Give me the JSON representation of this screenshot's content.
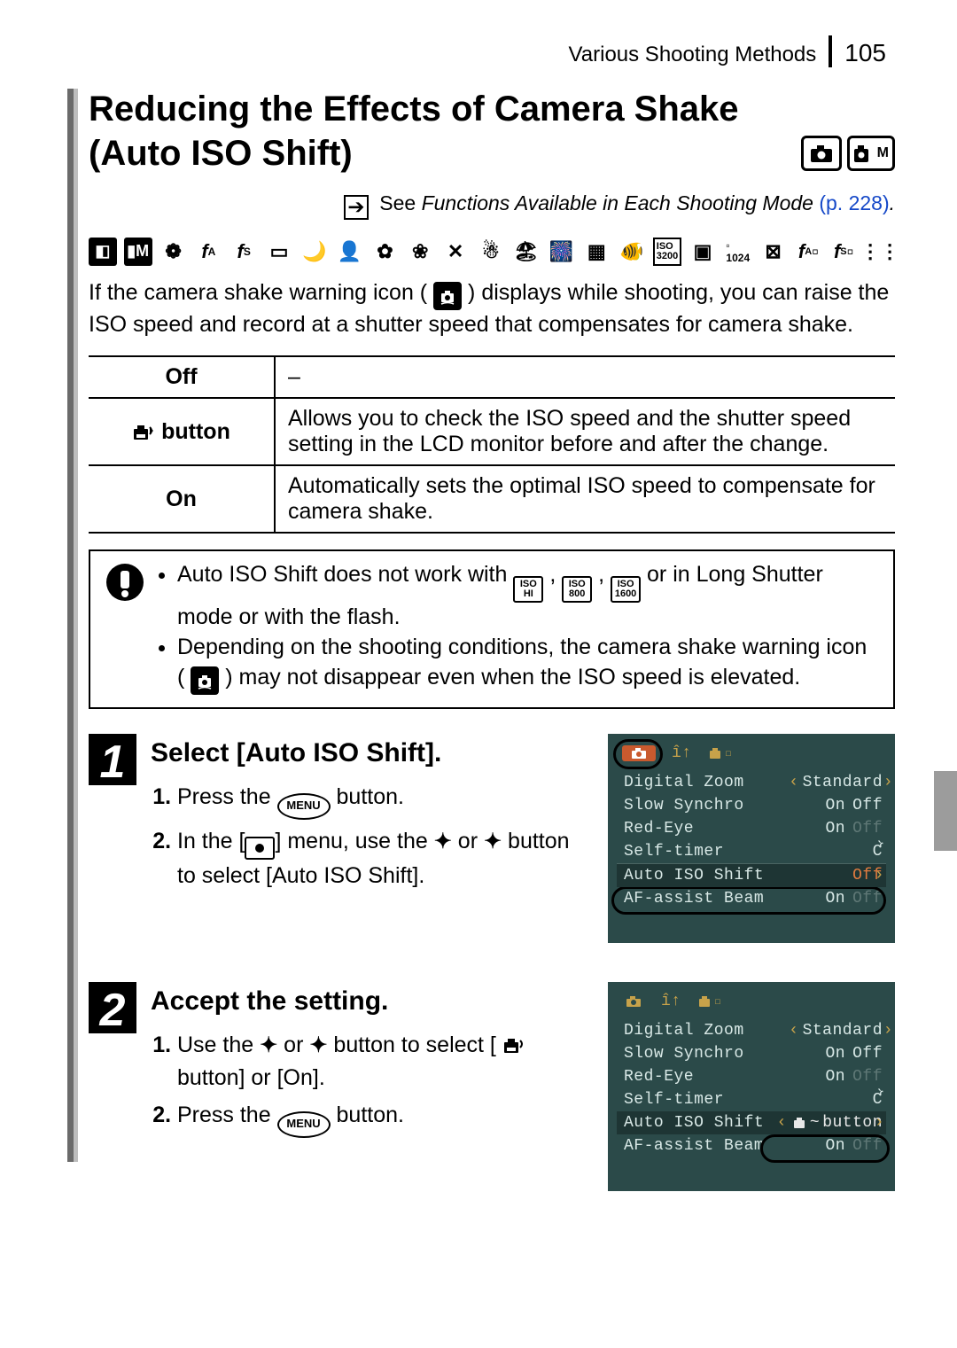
{
  "header": {
    "section": "Various Shooting Methods",
    "page": "105"
  },
  "title": {
    "line1": "Reducing the Effects of Camera Shake",
    "line2": "(Auto ISO Shift)"
  },
  "seelink": {
    "see": "See",
    "text": "Functions Available in Each Shooting Mode",
    "pref": "(p. 228)"
  },
  "intro": {
    "p1a": "If the camera shake warning icon (",
    "p1b": ") displays while shooting, you can raise the ISO speed and record at a shutter speed that compensates for camera shake."
  },
  "table": {
    "r1k": "Off",
    "r1v": "–",
    "r2k": " button",
    "r2v": "Allows you to check the ISO speed and the shutter speed setting in the LCD monitor before and after the change.",
    "r3k": "On",
    "r3v": "Automatically sets the optimal ISO speed to compensate for camera shake."
  },
  "notes": {
    "b1a": "Auto ISO Shift does not work with ",
    "b1b": ", ",
    "b1c": ", ",
    "b1d": " or in Long Shutter mode or with the flash.",
    "iso1t": "ISO",
    "iso1b": "HI",
    "iso2t": "ISO",
    "iso2b": "800",
    "iso3t": "ISO",
    "iso3b": "1600",
    "b2a": "Depending on the shooting conditions, the camera shake warning icon (",
    "b2b": ") may not disappear even when the ISO speed is elevated."
  },
  "steps": {
    "s1": {
      "num": "1",
      "title": "Select [Auto ISO Shift].",
      "i1a": "Press the ",
      "i1b": " button.",
      "i2a": "In the [",
      "i2b": "] menu, use the ",
      "i2c": " or ",
      "i2d": " button to select [Auto ISO Shift]."
    },
    "s2": {
      "num": "2",
      "title": "Accept the setting.",
      "i1a": "Use the ",
      "i1b": " or ",
      "i1c": " button to select [",
      "i1d": " button] or [On].",
      "i2a": "Press the ",
      "i2b": " button."
    }
  },
  "menu_label": "MENU",
  "lcd": {
    "r1": "Digital Zoom",
    "r1v": "Standard",
    "r2": "Slow Synchro",
    "on": "On",
    "off": "Off",
    "r3": "Red-Eye",
    "r4": "Self-timer",
    "r5": "Auto ISO Shift",
    "r5v1": "Off",
    "r5v2": "button",
    "r6": "AF-assist Beam"
  }
}
